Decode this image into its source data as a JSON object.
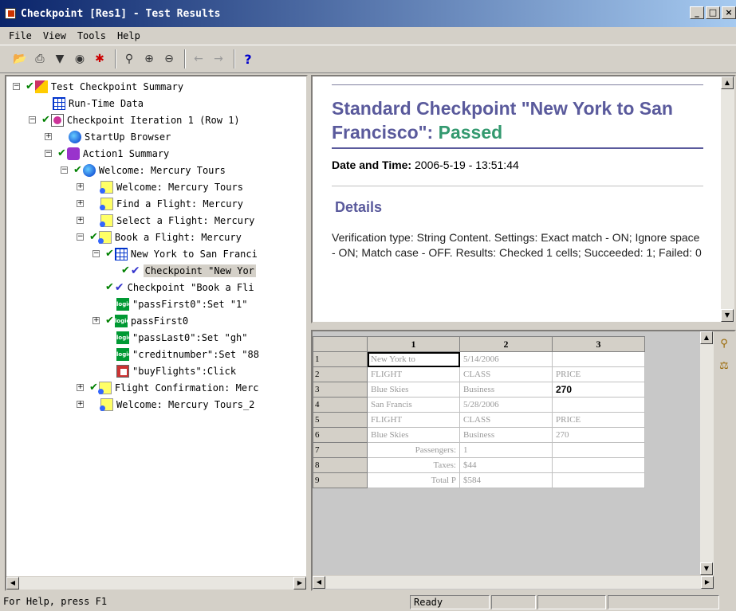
{
  "window": {
    "title": "Checkpoint [Res1] - Test Results",
    "minimize": "_",
    "maximize": "□",
    "close": "×"
  },
  "menu": [
    "File",
    "View",
    "Tools",
    "Help"
  ],
  "toolbar": {
    "icons": [
      "open-icon",
      "print-icon",
      "filter-icon",
      "find-icon",
      "bug-icon",
      "zoom-tree-icon",
      "zoom-in-icon",
      "zoom-out-icon",
      "back-icon",
      "forward-icon",
      "help-icon"
    ],
    "help_label": "?"
  },
  "tree": [
    {
      "label": "Test Checkpoint Summary",
      "icon": "summary",
      "depth": 0,
      "expander": "−",
      "checked": true
    },
    {
      "label": "Run-Time Data",
      "icon": "table",
      "depth": 1,
      "expander": "",
      "checked": false
    },
    {
      "label": "Checkpoint Iteration 1 (Row 1)",
      "icon": "iter",
      "depth": 1,
      "expander": "−",
      "checked": true
    },
    {
      "label": "StartUp Browser",
      "icon": "browser",
      "depth": 2,
      "expander": "+",
      "checked": false
    },
    {
      "label": "Action1 Summary",
      "icon": "action",
      "depth": 2,
      "expander": "−",
      "checked": true
    },
    {
      "label": "Welcome: Mercury Tours",
      "icon": "browser",
      "depth": 3,
      "expander": "−",
      "checked": true
    },
    {
      "label": "Welcome: Mercury Tours",
      "icon": "page",
      "depth": 4,
      "expander": "+",
      "checked": false
    },
    {
      "label": "Find a Flight: Mercury",
      "icon": "page",
      "depth": 4,
      "expander": "+",
      "checked": false
    },
    {
      "label": "Select a Flight: Mercury",
      "icon": "page",
      "depth": 4,
      "expander": "+",
      "checked": false
    },
    {
      "label": "Book a Flight: Mercury",
      "icon": "page",
      "depth": 4,
      "expander": "−",
      "checked": true
    },
    {
      "label": "New York to San Franci",
      "icon": "table",
      "depth": 5,
      "expander": "−",
      "checked": true
    },
    {
      "label": "Checkpoint \"New Yor",
      "icon": "checkpoint",
      "depth": 6,
      "expander": "",
      "checked": true,
      "selected": true
    },
    {
      "label": "Checkpoint \"Book a Fli",
      "icon": "checkpoint",
      "depth": 5,
      "expander": "",
      "checked": true
    },
    {
      "label": "\"passFirst0\":Set \"1\"",
      "icon": "logic",
      "depth": 5,
      "expander": "",
      "checked": false
    },
    {
      "label": "passFirst0",
      "icon": "logic",
      "depth": 5,
      "expander": "+",
      "checked": true
    },
    {
      "label": "\"passLast0\":Set \"gh\"",
      "icon": "logic",
      "depth": 5,
      "expander": "",
      "checked": false
    },
    {
      "label": "\"creditnumber\":Set \"88",
      "icon": "logic",
      "depth": 5,
      "expander": "",
      "checked": false
    },
    {
      "label": "\"buyFlights\":Click",
      "icon": "click",
      "depth": 5,
      "expander": "",
      "checked": false
    },
    {
      "label": "Flight Confirmation: Merc",
      "icon": "page",
      "depth": 4,
      "expander": "+",
      "checked": true
    },
    {
      "label": "Welcome: Mercury Tours_2",
      "icon": "page",
      "depth": 4,
      "expander": "+",
      "checked": false
    }
  ],
  "report": {
    "title_prefix": "Standard Checkpoint \"New York to San Francisco\":",
    "status": "Passed",
    "datetime_label": "Date and Time:",
    "datetime_value": "2006-5-19 - 13:51:44",
    "details_heading": "Details",
    "details_text": "Verification type: String Content. Settings: Exact match - ON; Ignore space - ON; Match case - OFF. Results: Checked 1 cells; Succeeded: 1; Failed: 0"
  },
  "grid": {
    "columns": [
      "1",
      "2",
      "3"
    ],
    "rows": [
      {
        "num": "1",
        "cells": [
          "New York to",
          "5/14/2006",
          ""
        ]
      },
      {
        "num": "2",
        "cells": [
          "FLIGHT",
          "CLASS",
          "PRICE"
        ]
      },
      {
        "num": "3",
        "cells": [
          "Blue Skies",
          "Business",
          "270"
        ]
      },
      {
        "num": "4",
        "cells": [
          "San Francis",
          "5/28/2006",
          ""
        ]
      },
      {
        "num": "5",
        "cells": [
          "FLIGHT",
          "CLASS",
          "PRICE"
        ]
      },
      {
        "num": "6",
        "cells": [
          "Blue Skies",
          "Business",
          "270"
        ]
      },
      {
        "num": "7",
        "cells": [
          "Passengers:",
          "1",
          ""
        ]
      },
      {
        "num": "8",
        "cells": [
          "Taxes:",
          "$44",
          ""
        ]
      },
      {
        "num": "9",
        "cells": [
          "Total P",
          "$584",
          ""
        ]
      }
    ]
  },
  "status": {
    "help": "For Help, press F1",
    "state": "Ready"
  }
}
